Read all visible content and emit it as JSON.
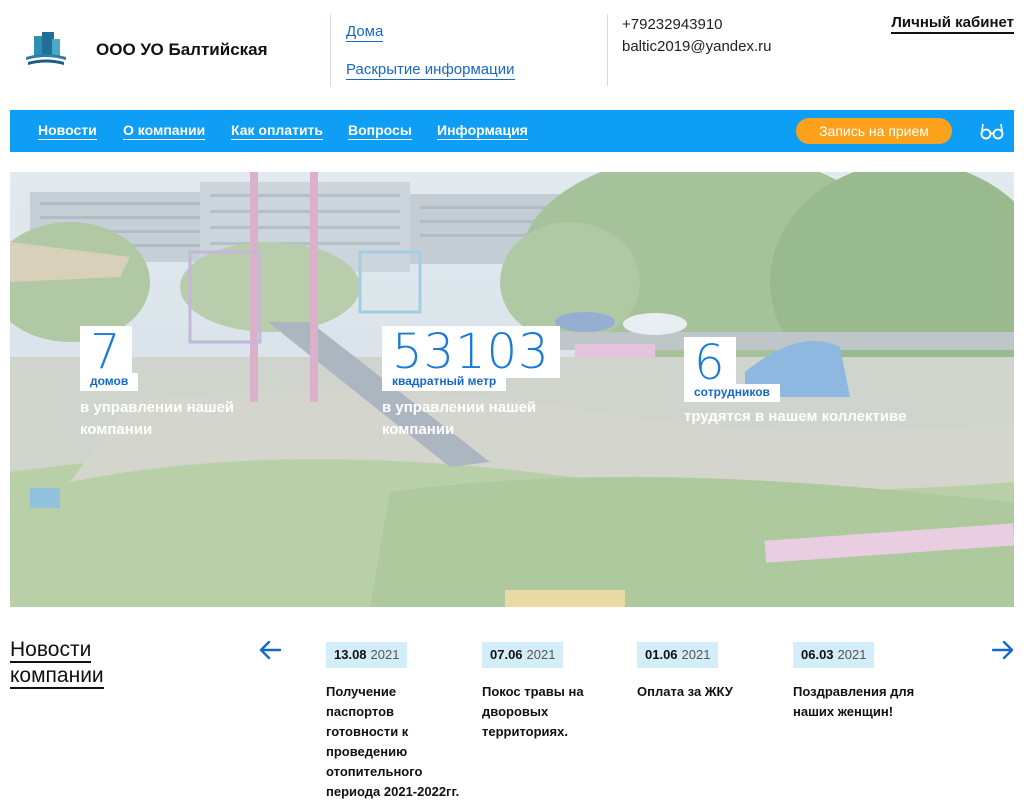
{
  "header": {
    "company_name": "ООО УО Балтийская",
    "links": {
      "houses": "Дома",
      "disclosure": "Раскрытие информации"
    },
    "phone": "+79232943910",
    "email": "baltic2019@yandex.ru",
    "cabinet": "Личный кабинет"
  },
  "nav": {
    "items": [
      "Новости",
      "О компании",
      "Как оплатить",
      "Вопросы",
      "Информация"
    ],
    "appointment_button": "Запись на прием",
    "accessibility_icon": "glasses-icon"
  },
  "stats": [
    {
      "value": "7",
      "unit": "домов",
      "description": "в управлении нашей компании"
    },
    {
      "value": "53103",
      "unit": "квадратный метр",
      "description": "в управлении нашей компании"
    },
    {
      "value": "6",
      "unit": "сотрудников",
      "description": "трудятся в нашем коллективе"
    }
  ],
  "news": {
    "title_line1": "Новости",
    "title_line2": "компании",
    "prev_icon": "arrow-left-icon",
    "next_icon": "arrow-right-icon",
    "items": [
      {
        "day_month": "13.08",
        "year": "2021",
        "text": "Получение паспортов готовности к проведению отопительного периода 2021-2022гг."
      },
      {
        "day_month": "07.06",
        "year": "2021",
        "text": "Покос травы на дворовых территориях."
      },
      {
        "day_month": "01.06",
        "year": "2021",
        "text": "Оплата за ЖКУ"
      },
      {
        "day_month": "06.03",
        "year": "2021",
        "text": "Поздравления для наших женщин!"
      }
    ]
  },
  "colors": {
    "nav_bg": "#0f9ef5",
    "accent_orange": "#fba11b",
    "link_blue": "#1769c9",
    "date_badge_bg": "#d3edf9"
  }
}
